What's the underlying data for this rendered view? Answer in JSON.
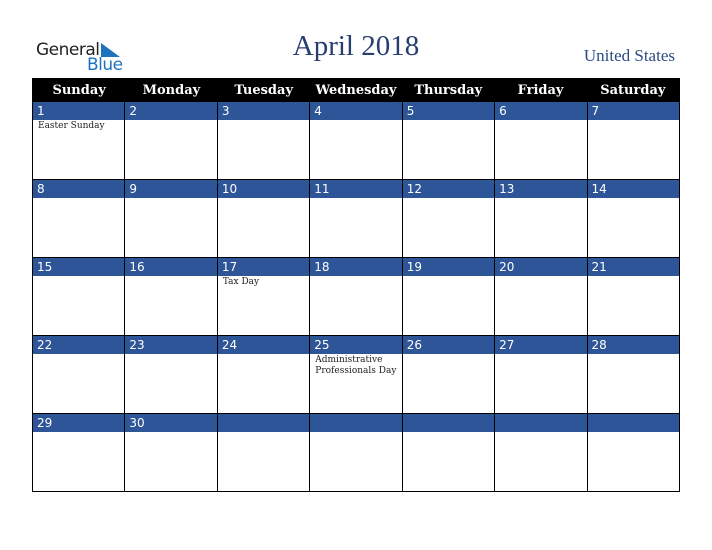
{
  "logo": {
    "line1": "General",
    "line2": "Blue"
  },
  "title": "April 2018",
  "country": "United States",
  "colors": {
    "date_bar": "#2d5597",
    "header_bg": "#000000",
    "title": "#283e70",
    "logo_blue": "#1e73be"
  },
  "weekdays": [
    "Sunday",
    "Monday",
    "Tuesday",
    "Wednesday",
    "Thursday",
    "Friday",
    "Saturday"
  ],
  "weeks": [
    [
      {
        "d": "1",
        "e": "Easter Sunday"
      },
      {
        "d": "2",
        "e": ""
      },
      {
        "d": "3",
        "e": ""
      },
      {
        "d": "4",
        "e": ""
      },
      {
        "d": "5",
        "e": ""
      },
      {
        "d": "6",
        "e": ""
      },
      {
        "d": "7",
        "e": ""
      }
    ],
    [
      {
        "d": "8",
        "e": ""
      },
      {
        "d": "9",
        "e": ""
      },
      {
        "d": "10",
        "e": ""
      },
      {
        "d": "11",
        "e": ""
      },
      {
        "d": "12",
        "e": ""
      },
      {
        "d": "13",
        "e": ""
      },
      {
        "d": "14",
        "e": ""
      }
    ],
    [
      {
        "d": "15",
        "e": ""
      },
      {
        "d": "16",
        "e": ""
      },
      {
        "d": "17",
        "e": "Tax Day"
      },
      {
        "d": "18",
        "e": ""
      },
      {
        "d": "19",
        "e": ""
      },
      {
        "d": "20",
        "e": ""
      },
      {
        "d": "21",
        "e": ""
      }
    ],
    [
      {
        "d": "22",
        "e": ""
      },
      {
        "d": "23",
        "e": ""
      },
      {
        "d": "24",
        "e": ""
      },
      {
        "d": "25",
        "e": "Administrative Professionals Day"
      },
      {
        "d": "26",
        "e": ""
      },
      {
        "d": "27",
        "e": ""
      },
      {
        "d": "28",
        "e": ""
      }
    ],
    [
      {
        "d": "29",
        "e": ""
      },
      {
        "d": "30",
        "e": ""
      },
      {
        "d": "",
        "e": ""
      },
      {
        "d": "",
        "e": ""
      },
      {
        "d": "",
        "e": ""
      },
      {
        "d": "",
        "e": ""
      },
      {
        "d": "",
        "e": ""
      }
    ]
  ]
}
